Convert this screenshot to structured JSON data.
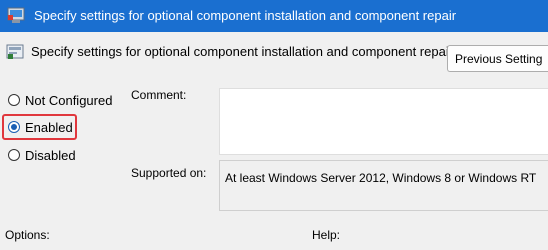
{
  "window": {
    "title": "Specify settings for optional component installation and component repair"
  },
  "header": {
    "title": "Specify settings for optional component installation and component repair",
    "previous_setting_label": "Previous Setting"
  },
  "options": {
    "items": [
      {
        "label": "Not Configured",
        "checked": false
      },
      {
        "label": "Enabled",
        "checked": true
      },
      {
        "label": "Disabled",
        "checked": false
      }
    ],
    "highlight_color": "#e0373d"
  },
  "comment": {
    "label": "Comment:",
    "value": ""
  },
  "supported_on": {
    "label": "Supported on:",
    "value": "At least Windows Server 2012, Windows 8 or Windows RT"
  },
  "sections": {
    "options_label": "Options:",
    "help_label": "Help:"
  },
  "colors": {
    "titlebar": "#1a6fd0",
    "accent": "#1a5fb4"
  }
}
